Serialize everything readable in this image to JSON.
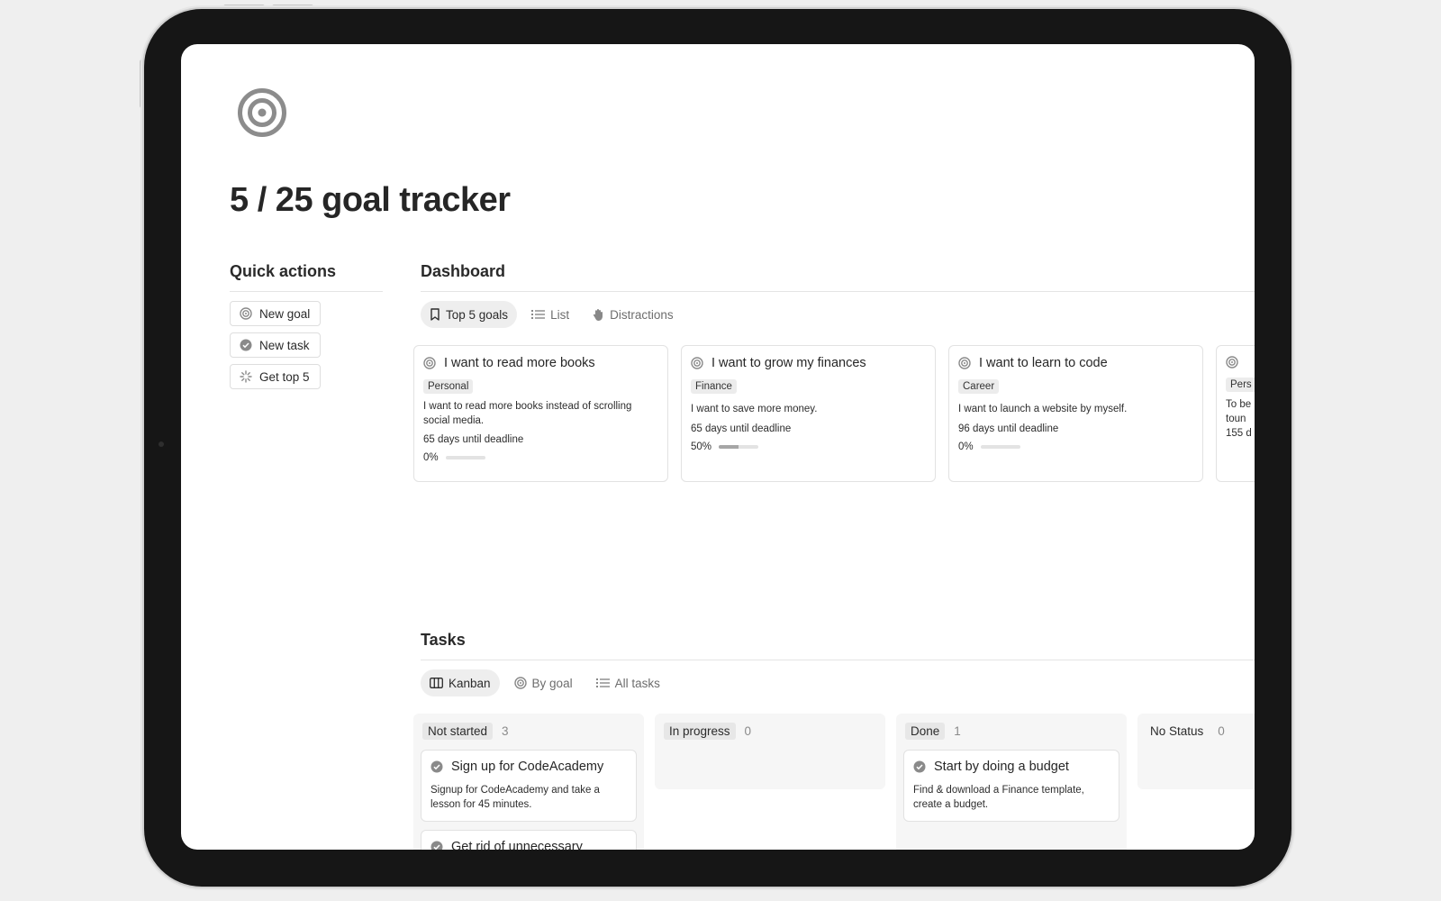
{
  "page": {
    "title": "5 / 25 goal tracker",
    "icon": "target-icon"
  },
  "quick_actions": {
    "heading": "Quick actions",
    "items": [
      {
        "label": "New goal",
        "icon": "target-icon"
      },
      {
        "label": "New task",
        "icon": "check-circle-icon"
      },
      {
        "label": "Get top 5",
        "icon": "sparkle-icon"
      }
    ]
  },
  "dashboard": {
    "heading": "Dashboard",
    "tabs": [
      {
        "label": "Top 5 goals",
        "icon": "bookmark-icon",
        "active": true
      },
      {
        "label": "List",
        "icon": "list-icon",
        "active": false
      },
      {
        "label": "Distractions",
        "icon": "hand-icon",
        "active": false
      }
    ],
    "goals": [
      {
        "title": "I want to read more books",
        "tag": "Personal",
        "description": "I want to read more books instead of scrolling social media.",
        "deadline": "65 days until deadline",
        "progress_label": "0%",
        "progress": 0.0
      },
      {
        "title": "I want to grow my finances",
        "tag": "Finance",
        "description": "I want to save more money.",
        "deadline": "65 days until deadline",
        "progress_label": "50%",
        "progress": 0.5
      },
      {
        "title": "I want to learn to code",
        "tag": "Career",
        "description": "I want to launch a website by myself.",
        "deadline": "96 days until deadline",
        "progress_label": "0%",
        "progress": 0.0
      },
      {
        "title": "",
        "tag": "Pers",
        "description": "To be",
        "description2": "toun",
        "deadline": "155 d"
      }
    ]
  },
  "tasks": {
    "heading": "Tasks",
    "tabs": [
      {
        "label": "Kanban",
        "icon": "board-icon",
        "active": true
      },
      {
        "label": "By goal",
        "icon": "target-icon",
        "active": false
      },
      {
        "label": "All tasks",
        "icon": "list-icon",
        "active": false
      }
    ],
    "columns": [
      {
        "label": "Not started",
        "count": "3",
        "cards": [
          {
            "title": "Sign up for CodeAcademy",
            "description": "Signup for CodeAcademy and take a lesson for 45 minutes."
          },
          {
            "title": "Get rid of unnecessary"
          }
        ]
      },
      {
        "label": "In progress",
        "count": "0",
        "cards": []
      },
      {
        "label": "Done",
        "count": "1",
        "cards": [
          {
            "title": "Start by doing a budget",
            "description": "Find & download a Finance template, create a budget."
          }
        ]
      },
      {
        "label": "No Status",
        "count": "0",
        "cards": []
      }
    ]
  },
  "colors": {
    "frame": "#161616",
    "background": "#efefef",
    "text": "#2b2b2b",
    "muted": "#6d6d6d",
    "tab_active_bg": "#eeeeee"
  }
}
